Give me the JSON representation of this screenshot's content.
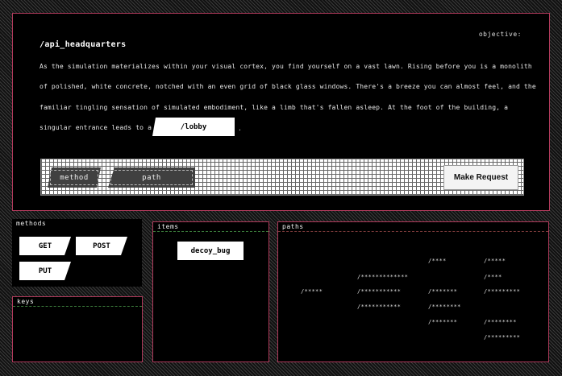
{
  "main": {
    "objective_label": "objective:",
    "title": "/api_headquarters",
    "story_lines": [
      "As the simulation materializes within your visual cortex, you find yourself on a vast lawn. Rising before you is a monolith",
      "of polished, white concrete, notched with an even grid of black glass windows. There's a breeze you can almost feel, and the",
      "familiar tingling sensation of simulated embodiment, like a limb that's fallen asleep. At the foot of the building, a",
      "singular entrance leads to a"
    ],
    "lobby_link": "/lobby",
    "trailing": "."
  },
  "request": {
    "method_placeholder": "method",
    "path_placeholder": "path",
    "submit_label": "Make Request"
  },
  "methods": {
    "title": "methods",
    "items": [
      "GET",
      "POST",
      "PUT"
    ]
  },
  "keys": {
    "title": "keys"
  },
  "items": {
    "title": "items",
    "entries": [
      "decoy_bug"
    ]
  },
  "paths": {
    "title": "paths",
    "nodes": [
      "/*****",
      "/*************",
      "/***********",
      "/***********",
      "/****",
      "/*******",
      "/********",
      "/*******",
      "/*****",
      "/****",
      "/*********",
      "/********",
      "/*********"
    ]
  }
}
